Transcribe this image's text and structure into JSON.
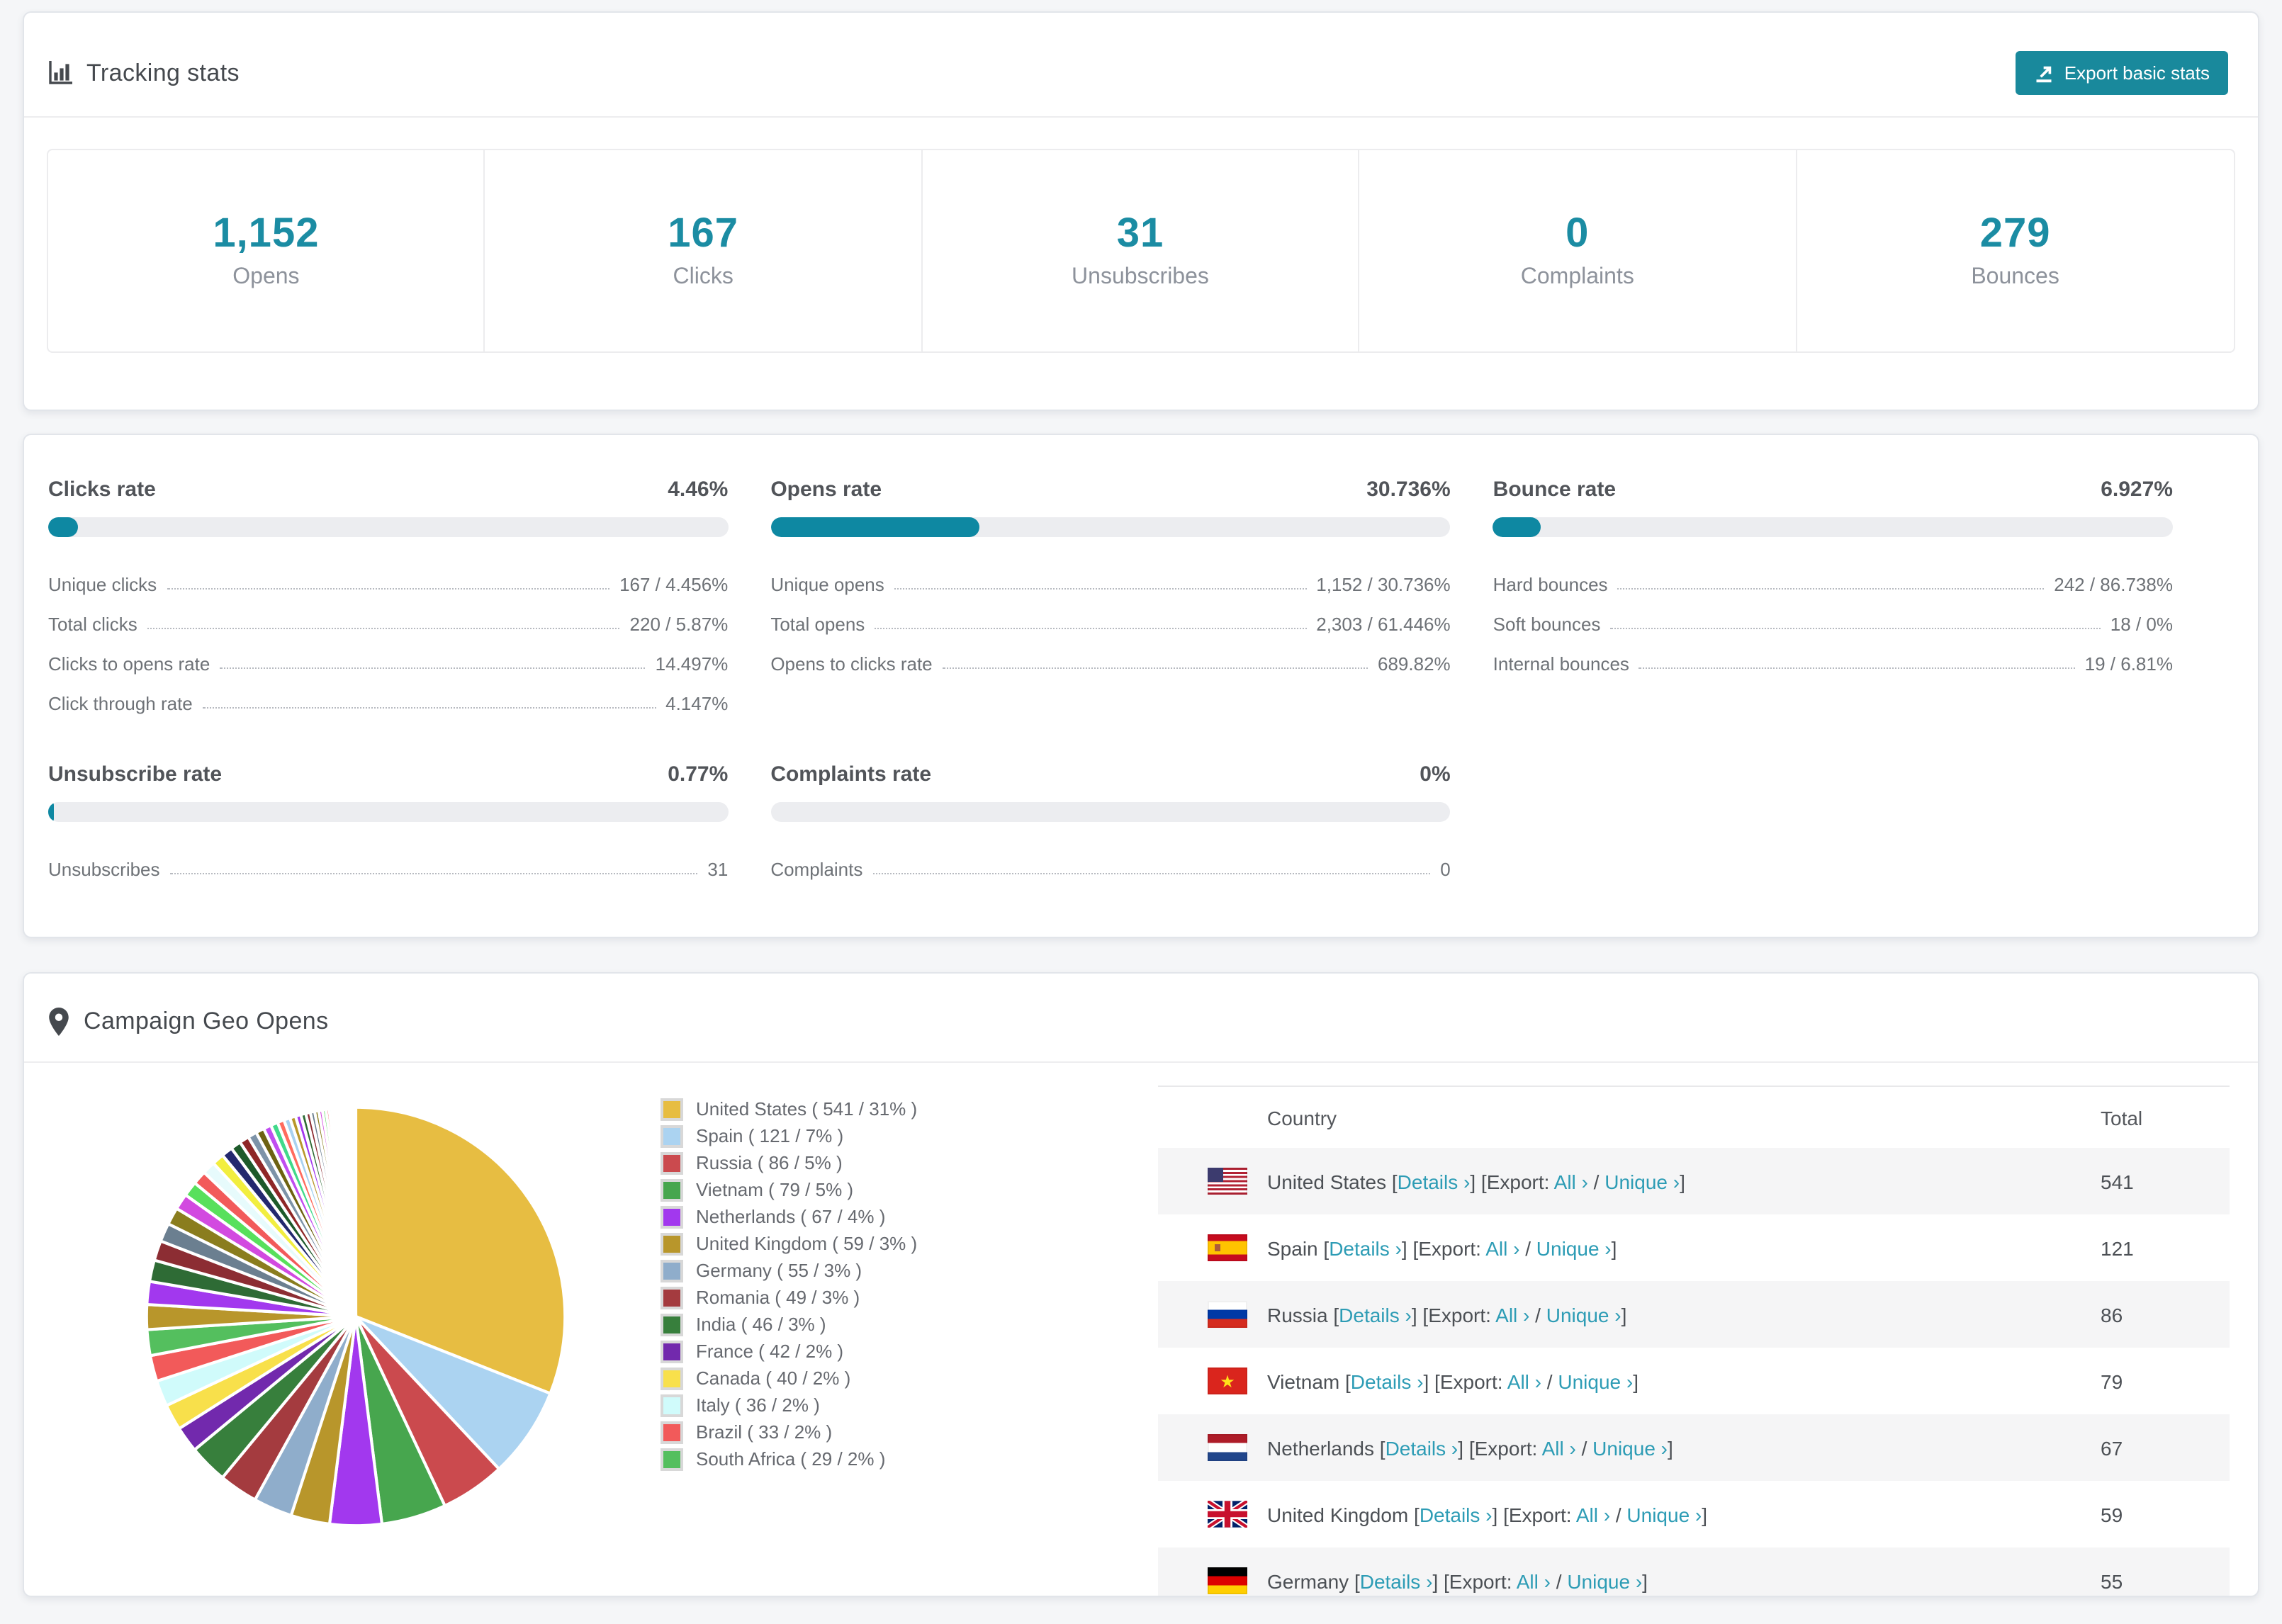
{
  "colors": {
    "accent": "#1b8ca3",
    "button": "#19899c",
    "link": "#2d9cb5",
    "bar_track": "#ecedf0",
    "bar_fill": "#0e88a2"
  },
  "tracking": {
    "title": "Tracking stats",
    "export_button": "Export basic stats",
    "stats": [
      {
        "value": "1,152",
        "label": "Opens"
      },
      {
        "value": "167",
        "label": "Clicks"
      },
      {
        "value": "31",
        "label": "Unsubscribes"
      },
      {
        "value": "0",
        "label": "Complaints"
      },
      {
        "value": "279",
        "label": "Bounces"
      }
    ]
  },
  "rates": {
    "sections": [
      {
        "id": "clicks-rate",
        "title": "Clicks rate",
        "value": "4.46%",
        "percent": 4.46,
        "rows": [
          {
            "label": "Unique clicks",
            "value": "167 / 4.456%"
          },
          {
            "label": "Total clicks",
            "value": "220 / 5.87%"
          },
          {
            "label": "Clicks to opens rate",
            "value": "14.497%"
          },
          {
            "label": "Click through rate",
            "value": "4.147%"
          }
        ]
      },
      {
        "id": "opens-rate",
        "title": "Opens rate",
        "value": "30.736%",
        "percent": 30.736,
        "rows": [
          {
            "label": "Unique opens",
            "value": "1,152 / 30.736%"
          },
          {
            "label": "Total opens",
            "value": "2,303 / 61.446%"
          },
          {
            "label": "Opens to clicks rate",
            "value": "689.82%"
          }
        ]
      },
      {
        "id": "bounce-rate",
        "title": "Bounce rate",
        "value": "6.927%",
        "percent": 6.927,
        "rows": [
          {
            "label": "Hard bounces",
            "value": "242 / 86.738%"
          },
          {
            "label": "Soft bounces",
            "value": "18 / 0%"
          },
          {
            "label": "Internal bounces",
            "value": "19 / 6.81%"
          }
        ]
      },
      {
        "id": "unsubscribe-rate",
        "title": "Unsubscribe rate",
        "value": "0.77%",
        "percent": 0.77,
        "rows": [
          {
            "label": "Unsubscribes",
            "value": "31"
          }
        ]
      },
      {
        "id": "complaints-rate",
        "title": "Complaints rate",
        "value": "0%",
        "percent": 0,
        "rows": [
          {
            "label": "Complaints",
            "value": "0"
          }
        ]
      }
    ]
  },
  "geo": {
    "title": "Campaign Geo Opens",
    "chart_data": {
      "type": "pie",
      "title": "Campaign Geo Opens",
      "labels": [
        "United States",
        "Spain",
        "Russia",
        "Vietnam",
        "Netherlands",
        "United Kingdom",
        "Germany",
        "Romania",
        "India",
        "France",
        "Canada",
        "Italy",
        "Brazil",
        "South Africa"
      ],
      "values": [
        541,
        121,
        86,
        79,
        67,
        59,
        55,
        49,
        46,
        42,
        40,
        36,
        33,
        29
      ],
      "percents": [
        31,
        7,
        5,
        5,
        4,
        3,
        3,
        3,
        3,
        2,
        2,
        2,
        2,
        2
      ],
      "colors": [
        "#e7bd42",
        "#abd3f1",
        "#cb4a4e",
        "#47a64e",
        "#a238ee",
        "#b8962b",
        "#8fadcb",
        "#a43b3f",
        "#377f3c",
        "#7229ad",
        "#f8e04b",
        "#d0fbfb",
        "#f25a5a",
        "#54bf5e"
      ],
      "other_tail_percent": 26,
      "legend_position": "right",
      "start_angle_deg": -90,
      "direction": "clockwise",
      "legend_format": "{label} ( {value} / {percent}% )"
    },
    "table": {
      "columns": [
        "Country",
        "Total"
      ],
      "links": {
        "open_bracket": "[",
        "details": "Details ›",
        "export_prefix": "] [Export: ",
        "all": "All ›",
        "separator": " / ",
        "unique": "Unique ›",
        "close_bracket": "]"
      },
      "rows": [
        {
          "country": "United States",
          "flag": "us",
          "total": "541"
        },
        {
          "country": "Spain",
          "flag": "es",
          "total": "121"
        },
        {
          "country": "Russia",
          "flag": "ru",
          "total": "86"
        },
        {
          "country": "Vietnam",
          "flag": "vn",
          "total": "79"
        },
        {
          "country": "Netherlands",
          "flag": "nl",
          "total": "67"
        },
        {
          "country": "United Kingdom",
          "flag": "gb",
          "total": "59"
        },
        {
          "country": "Germany",
          "flag": "de",
          "total": "55"
        }
      ]
    }
  }
}
